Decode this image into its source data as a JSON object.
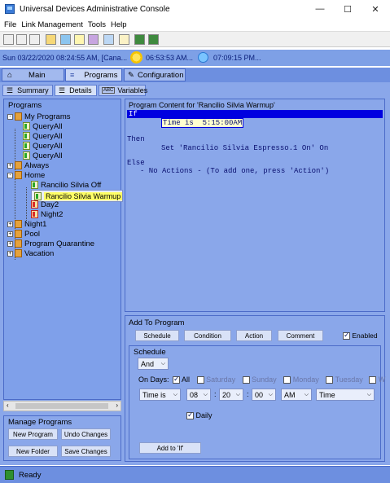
{
  "window": {
    "title": "Universal Devices Administrative Console",
    "minimize": "—",
    "maximize": "☐",
    "close": "✕"
  },
  "menu": [
    "File",
    "Link Management",
    "Tools",
    "Help"
  ],
  "strip": {
    "date": "Sun 03/22/2020 08:24:55 AM,  [Cana...",
    "sunrise": "06:53:53 AM...",
    "sunset": "07:09:15 PM..."
  },
  "main_tabs": [
    "Main",
    "Programs",
    "Configuration"
  ],
  "sub_tabs": [
    "Summary",
    "Details",
    "Variables"
  ],
  "tree": {
    "header": "Programs",
    "nodes": [
      {
        "label": "My Programs",
        "type": "folder",
        "exp": "-"
      },
      {
        "label": "QueryAll",
        "type": "green"
      },
      {
        "label": "QueryAll",
        "type": "green"
      },
      {
        "label": "QueryAll",
        "type": "green"
      },
      {
        "label": "QueryAll",
        "type": "green"
      },
      {
        "label": "Always",
        "type": "folder",
        "exp": "+"
      },
      {
        "label": "Home",
        "type": "folder",
        "exp": "-"
      },
      {
        "label": "Rancilio Silvia Off",
        "type": "green"
      },
      {
        "label": "Rancilio Silvia Warmup",
        "type": "green",
        "selected": true
      },
      {
        "label": "Day2",
        "type": "red"
      },
      {
        "label": "Night2",
        "type": "red"
      },
      {
        "label": "Night1",
        "type": "folder",
        "exp": "+"
      },
      {
        "label": "Pool",
        "type": "folder",
        "exp": "+"
      },
      {
        "label": "Program Quarantine",
        "type": "folder",
        "exp": "+"
      },
      {
        "label": "Vacation",
        "type": "folder",
        "exp": "+"
      }
    ]
  },
  "manage": {
    "title": "Manage Programs",
    "new_program": "New Program",
    "undo_changes": "Undo Changes",
    "new_folder": "New Folder",
    "save_changes": "Save Changes"
  },
  "content": {
    "caption": "Program Content for 'Rancilio Silvia Warmup'",
    "if_kw": "If",
    "condition": "Time is  5:15:00AM",
    "then_kw": "Then",
    "then_action": "Set 'Rancilio Silvia Espresso.1 On' On",
    "else_kw": "Else",
    "else_action": "- No Actions - (To add one, press 'Action')"
  },
  "add": {
    "title": "Add To Program",
    "buttons": [
      "Schedule",
      "Condition",
      "Action",
      "Comment"
    ],
    "enabled_label": "Enabled",
    "schedule_title": "Schedule",
    "and_value": "And",
    "on_days_label": "On Days:",
    "all_label": "All",
    "days": [
      "Saturday",
      "Sunday",
      "Monday",
      "Tuesday",
      "W"
    ],
    "time_is": "Time is",
    "hour": "08",
    "minute": "20",
    "second": "00",
    "ampm": "AM",
    "time_type": "Time",
    "daily_label": "Daily",
    "add_to_if": "Add to 'If'"
  },
  "status": {
    "text": "Ready"
  }
}
